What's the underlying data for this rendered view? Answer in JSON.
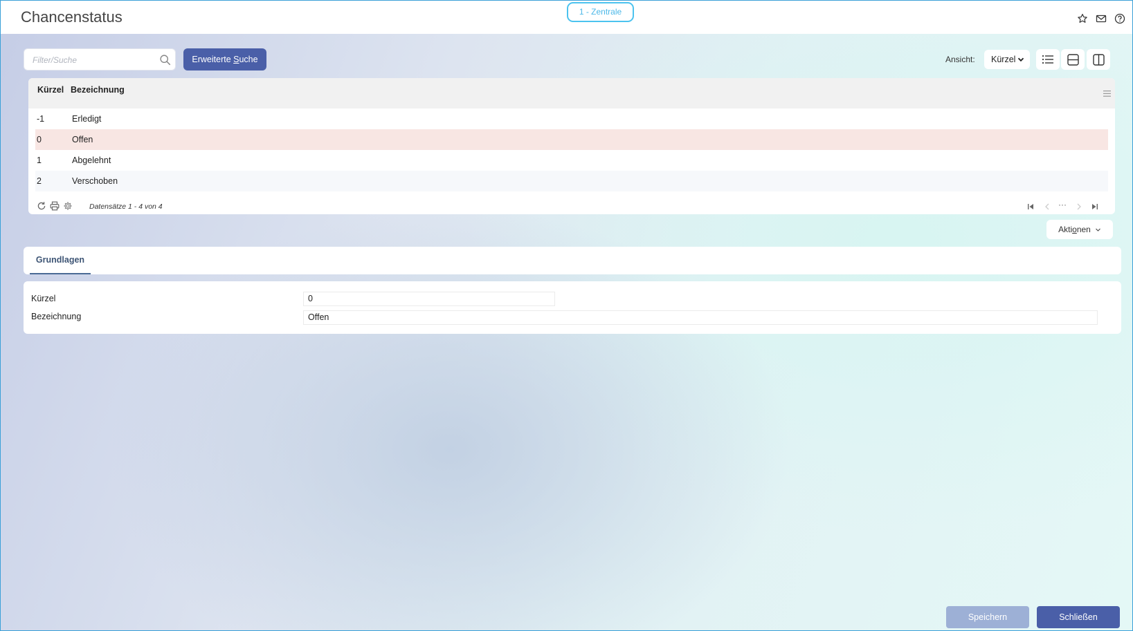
{
  "header": {
    "title": "Chancenstatus",
    "tenant": "1 - Zentrale",
    "icons": [
      "star-icon",
      "mail-icon",
      "help-icon"
    ]
  },
  "toolbar": {
    "search_placeholder": "Filter/Suche",
    "search_value": "",
    "ext_search_prefix": "Erweiterte ",
    "ext_search_hotkey": "S",
    "ext_search_suffix": "uche",
    "view_label": "Ansicht:",
    "view_value": "Kürzel"
  },
  "grid": {
    "columns": [
      "Kürzel",
      "Bezeichnung"
    ],
    "rows": [
      {
        "kuerzel": "-1",
        "bezeichnung": "Erledigt"
      },
      {
        "kuerzel": "0",
        "bezeichnung": "Offen"
      },
      {
        "kuerzel": "1",
        "bezeichnung": "Abgelehnt"
      },
      {
        "kuerzel": "2",
        "bezeichnung": "Verschoben"
      }
    ],
    "selected_row": 1,
    "record_info": "Datensätze 1 - 4 von 4",
    "pager_ellipsis": "···"
  },
  "actions": {
    "label_prefix": "Akti",
    "label_hotkey": "o",
    "label_suffix": "nen"
  },
  "tabs": [
    {
      "label": "Grundlagen"
    }
  ],
  "form": {
    "kuerzel_label": "Kürzel",
    "kuerzel_value": "0",
    "bezeichnung_label": "Bezeichnung",
    "bezeichnung_value": "Offen"
  },
  "footer": {
    "save_label": "Speichern",
    "close_label": "Schließen"
  },
  "colors": {
    "primary": "#4a5fa8",
    "primary_disabled": "#9db0d6",
    "tenant_border": "#4cc3ef",
    "selected_row": "#f8e6e3"
  }
}
